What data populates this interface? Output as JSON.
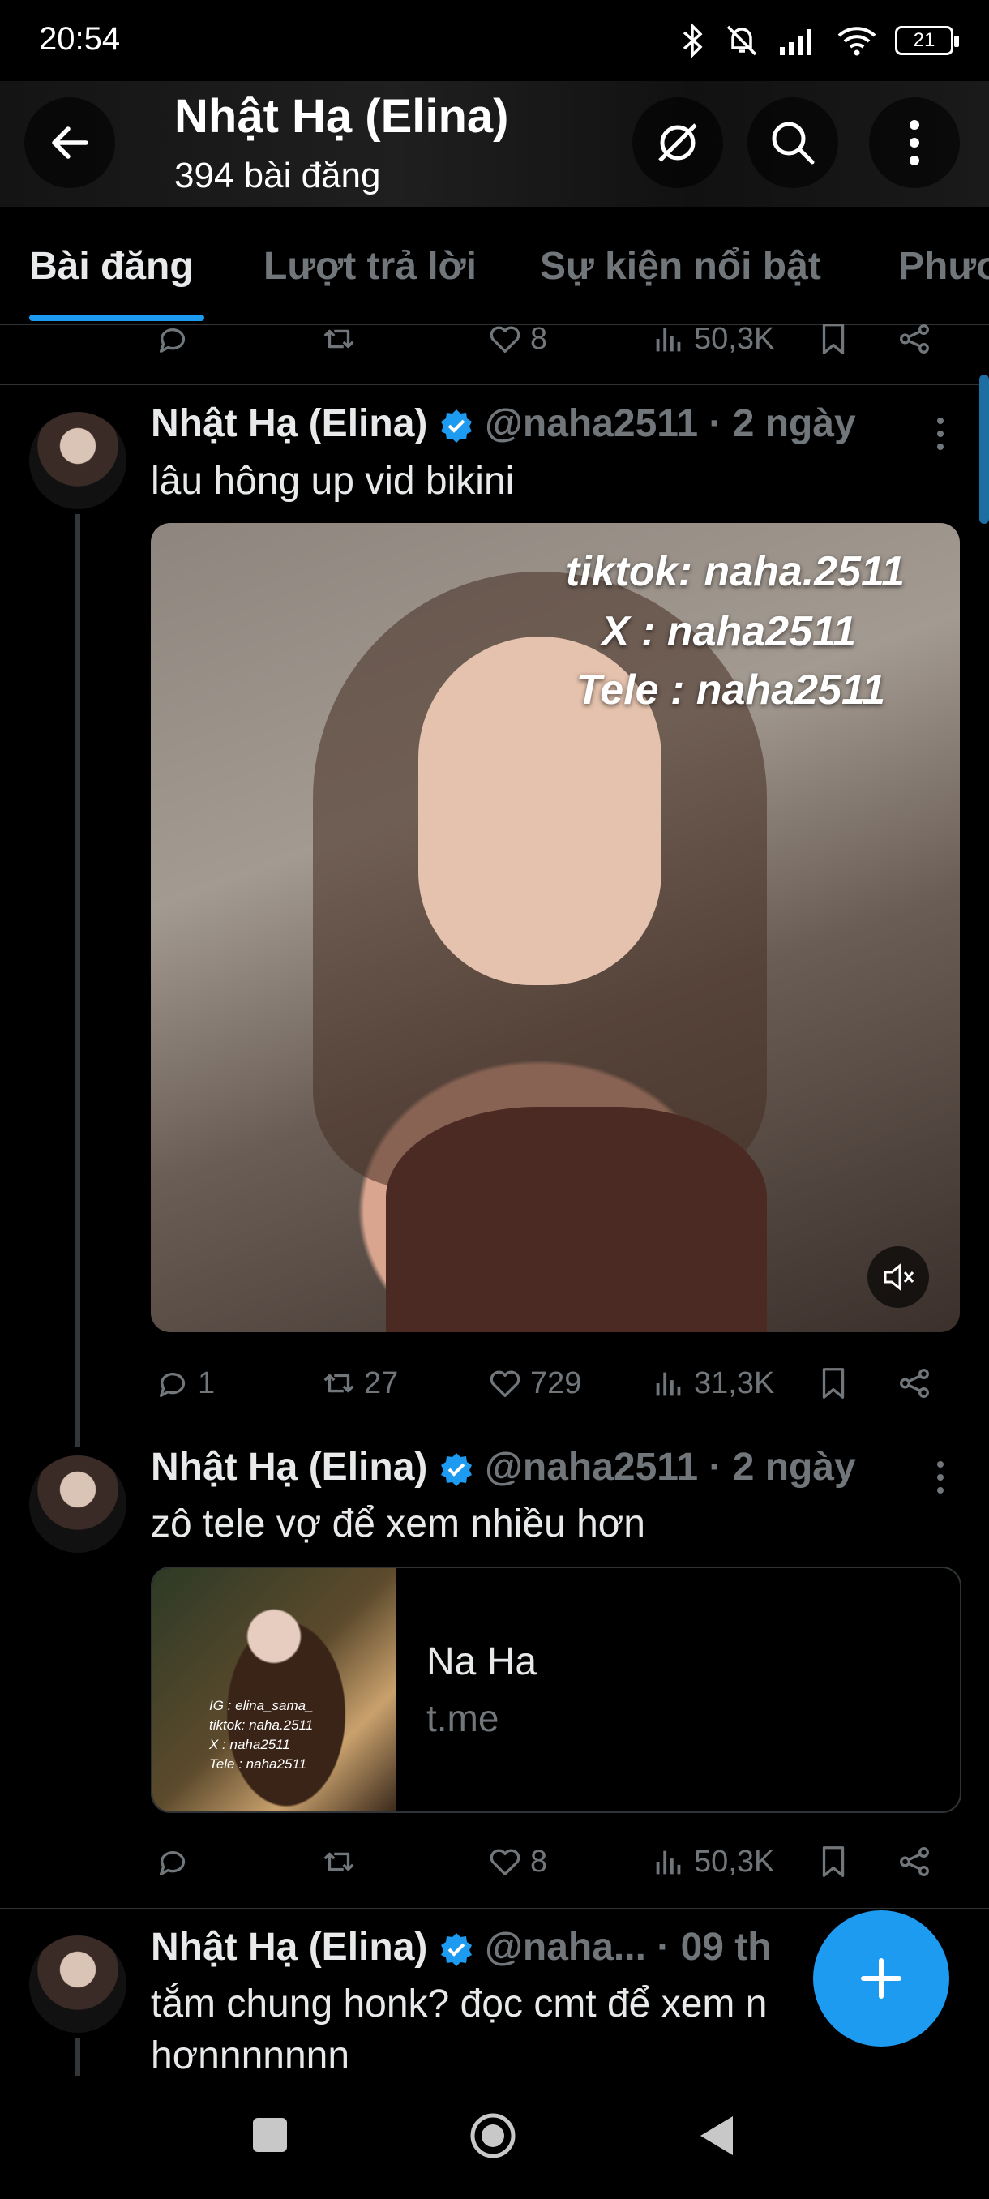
{
  "status_bar": {
    "time": "20:54",
    "battery": "21"
  },
  "header": {
    "title": "Nhật Hạ (Elina)",
    "subtitle": "394 bài đăng"
  },
  "tabs": [
    {
      "label": "Bài đăng"
    },
    {
      "label": "Lượt trả lời"
    },
    {
      "label": "Sự kiện nổi bật"
    },
    {
      "label": "Phươ"
    }
  ],
  "prev_tweet_actions": {
    "replies": "",
    "reposts": "",
    "likes": "8",
    "views": "50,3K"
  },
  "tweets": [
    {
      "name": "Nhật Hạ (Elina)",
      "meta": "@naha2511 · 2 ngày",
      "text": "lâu hông up vid bikini",
      "media_overlay": [
        "tiktok: naha.2511",
        "X : naha2511",
        "Tele : naha2511"
      ],
      "actions": {
        "replies": "1",
        "reposts": "27",
        "likes": "729",
        "views": "31,3K"
      }
    },
    {
      "name": "Nhật Hạ (Elina)",
      "meta": "@naha2511 · 2 ngày",
      "text": "zô tele vợ để xem nhiều hơn",
      "card": {
        "title": "Na Ha",
        "domain": "t.me",
        "image_text": [
          "IG : elina_sama_",
          "tiktok: naha.2511",
          "X : naha2511",
          "Tele : naha2511"
        ]
      },
      "actions": {
        "replies": "",
        "reposts": "",
        "likes": "8",
        "views": "50,3K"
      }
    },
    {
      "name": "Nhật Hạ (Elina)",
      "meta": "@naha...  · 09 th",
      "text_line1": "tắm chung honk? đọc cmt để xem n",
      "text_line2": "hơnnnnnnn"
    }
  ],
  "colors": {
    "accent": "#1d9bf0",
    "text": "#e7e9ea",
    "muted": "#71767b",
    "background": "#000000"
  },
  "icons": [
    "back-arrow-icon",
    "grok-icon",
    "search-icon",
    "more-vertical-icon",
    "reply-icon",
    "repost-icon",
    "like-icon",
    "views-icon",
    "bookmark-icon",
    "share-icon",
    "verified-icon",
    "mute-icon",
    "plus-icon"
  ]
}
